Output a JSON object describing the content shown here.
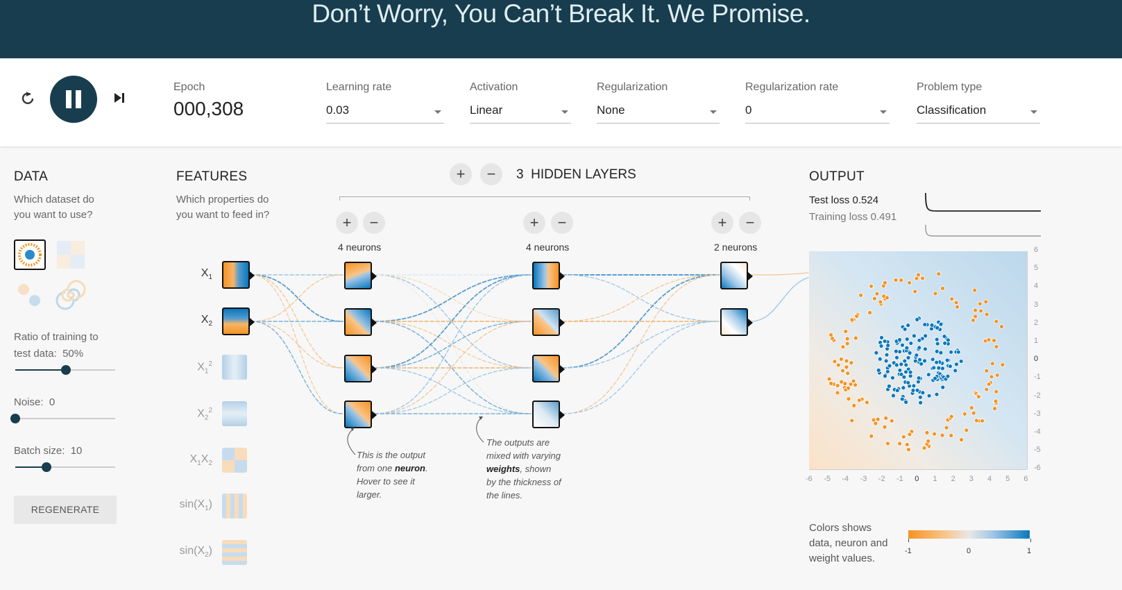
{
  "banner": {
    "title": "Don’t Worry, You Can’t Break It. We Promise."
  },
  "controls": {
    "epoch_label": "Epoch",
    "epoch_value": "000,308",
    "learning_rate": {
      "label": "Learning rate",
      "value": "0.03"
    },
    "activation": {
      "label": "Activation",
      "value": "Linear"
    },
    "regularization": {
      "label": "Regularization",
      "value": "None"
    },
    "regularization_rate": {
      "label": "Regularization rate",
      "value": "0"
    },
    "problem_type": {
      "label": "Problem type",
      "value": "Classification"
    }
  },
  "data_panel": {
    "title": "DATA",
    "question_line1": "Which dataset do",
    "question_line2": "you want to use?",
    "ratio_label_line1": "Ratio of training to",
    "ratio_label_line2": "test data:",
    "ratio_value": "50%",
    "ratio_fraction": 0.5,
    "noise_label": "Noise:",
    "noise_value": "0",
    "noise_fraction": 0.0,
    "batch_label": "Batch size:",
    "batch_value": "10",
    "batch_fraction": 0.31,
    "regenerate": "REGENERATE"
  },
  "features_panel": {
    "title": "FEATURES",
    "question_line1": "Which properties do",
    "question_line2": "you want to feed in?"
  },
  "network": {
    "layers_count": "3",
    "layers_label": "HIDDEN LAYERS",
    "layer1_neurons": "4 neurons",
    "layer2_neurons": "4 neurons",
    "layer3_neurons": "2 neurons",
    "note1": [
      "This is the output",
      "from one",
      "neuron",
      ". Hover to see it",
      "larger."
    ],
    "note2": [
      "The outputs are",
      "mixed with varying",
      "weights",
      ", shown",
      "by the thickness of",
      "the lines."
    ]
  },
  "output_panel": {
    "title": "OUTPUT",
    "test_loss": "Test loss 0.524",
    "training_loss": "Training loss 0.491",
    "y_ticks": [
      "6",
      "5",
      "4",
      "3",
      "2",
      "1",
      "0",
      "-1",
      "-2",
      "-3",
      "-4",
      "-5",
      "-6"
    ],
    "x_ticks": [
      "-6",
      "-5",
      "-4",
      "-3",
      "-2",
      "-1",
      "0",
      "1",
      "2",
      "3",
      "4",
      "5",
      "6"
    ],
    "legend_line1": "Colors shows",
    "legend_line2": "data, neuron and",
    "legend_line3": "weight values.",
    "legend_min": "-1",
    "legend_mid": "0",
    "legend_max": "1"
  },
  "colors": {
    "orange": "#f59322",
    "blue": "#0877bd",
    "banner": "#183d4e"
  }
}
